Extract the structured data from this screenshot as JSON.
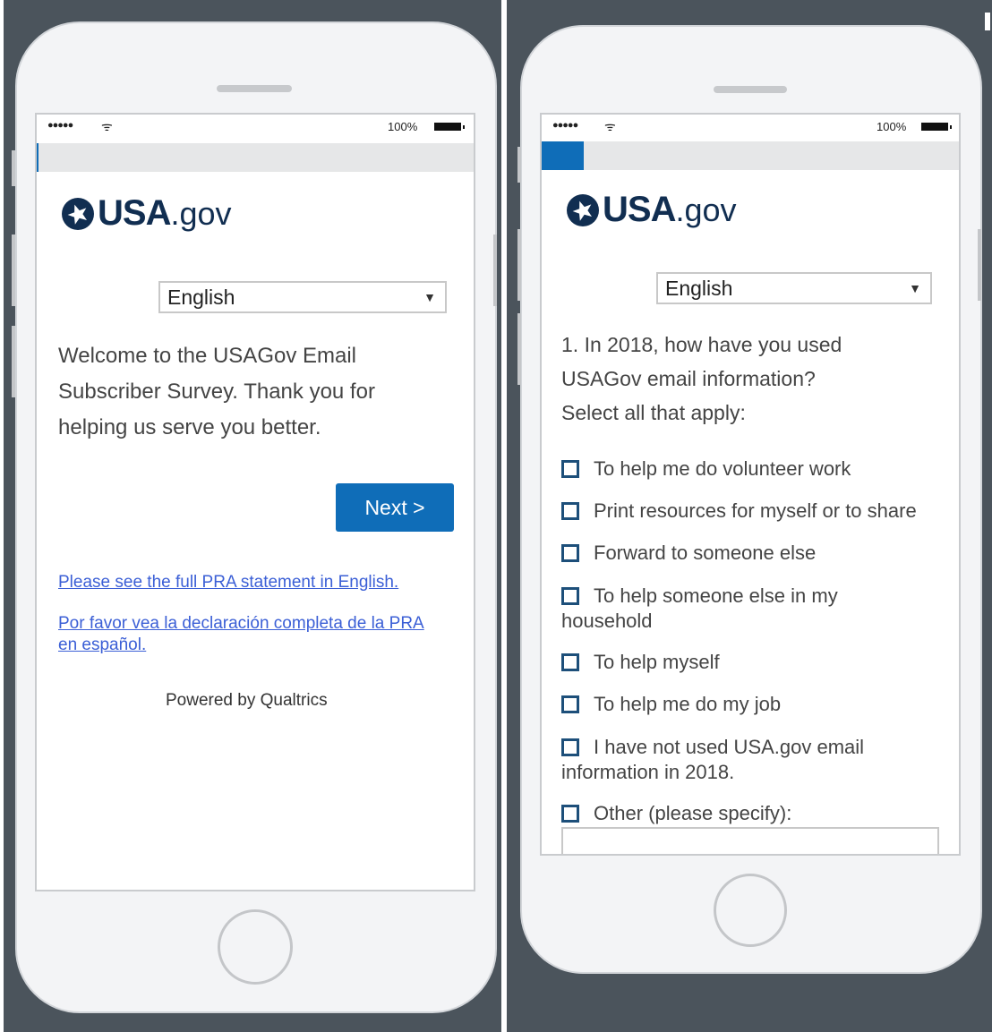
{
  "status_bar": {
    "signal": "●●●●●",
    "wifi": "ᯤ",
    "battery_percent": "100%"
  },
  "logo": {
    "usa": "USA",
    "gov": ".gov"
  },
  "screen1": {
    "language": "English",
    "welcome_text": "Welcome to the USAGov Email Subscriber Survey.  Thank you for helping us serve you better.",
    "next_button": "Next >",
    "pra_link_en": "Please see the full PRA statement in English.",
    "pra_link_es": "Por favor vea la declaración completa de la PRA en español.",
    "powered_by": "Powered by Qualtrics",
    "progress": 0
  },
  "screen2": {
    "language": "English",
    "question": "1. In 2018, how have you used USAGov email information?",
    "instruction": "Select all that apply:",
    "progress": 0.1,
    "options": [
      {
        "label": "To help me do volunteer work",
        "checked": false
      },
      {
        "label": "Print resources for myself or to share",
        "checked": false
      },
      {
        "label": "Forward to someone else",
        "checked": false
      },
      {
        "label": "To help someone else in my household",
        "checked": false
      },
      {
        "label": "To help myself",
        "checked": false
      },
      {
        "label": "To help me do my job",
        "checked": false
      },
      {
        "label": "I have not used USA.gov email information in 2018.",
        "checked": false
      },
      {
        "label": "Other (please specify):",
        "checked": false
      }
    ],
    "other_value": ""
  },
  "colors": {
    "panel": "#4b545c",
    "accent": "#0f6db8",
    "logo": "#112e51",
    "link": "#3b5fd6"
  }
}
